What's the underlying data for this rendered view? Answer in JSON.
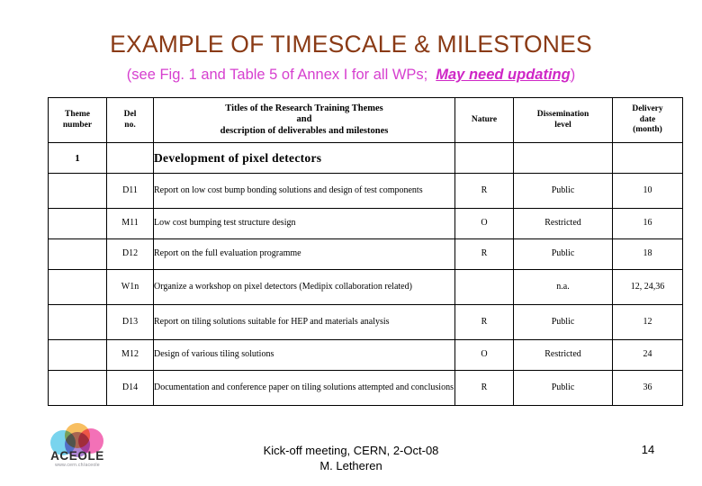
{
  "slide": {
    "title": "EXAMPLE OF TIMESCALE & MILESTONES",
    "subtitle_main": "(see Fig. 1 and Table 5 of Annex I for all WPs;",
    "subtitle_emphasis": "May need updating",
    "subtitle_close": ")",
    "title_color": "#8a3a15",
    "subtitle_color": "#d63fcf",
    "emphasis_color": "#cf27c6"
  },
  "table": {
    "headers": {
      "theme_number": "Theme\nnumber",
      "theme_number_line1": "Theme",
      "theme_number_line2": "number",
      "del_no_line1": "Del",
      "del_no_line2": "no.",
      "titles_line1": "Titles of the Research Training Themes",
      "titles_line2": "and",
      "titles_line3": "description of deliverables and milestones",
      "nature": "Nature",
      "dissemination_line1": "Dissemination",
      "dissemination_line2": "level",
      "delivery_line1": "Delivery",
      "delivery_line2": "date",
      "delivery_line3": "(month)"
    },
    "theme_row": {
      "number": "1",
      "title": "Development of pixel detectors"
    },
    "rows": [
      {
        "theme": "",
        "del_no": "D11",
        "description": "Report on low cost bump bonding solutions and design of test components",
        "nature": "R",
        "dissemination": "Public",
        "delivery": "10"
      },
      {
        "theme": "",
        "del_no": "M11",
        "description": "Low cost bumping test structure design",
        "nature": "O",
        "dissemination": "Restricted",
        "delivery": "16"
      },
      {
        "theme": "",
        "del_no": "D12",
        "description": "Report on the full evaluation programme",
        "nature": "R",
        "dissemination": "Public",
        "delivery": "18"
      },
      {
        "theme": "",
        "del_no": "W1n",
        "description": "Organize a workshop on pixel detectors (Medipix collaboration related)",
        "nature": "",
        "dissemination": "n.a.",
        "delivery": "12, 24,36"
      },
      {
        "theme": "",
        "del_no": "D13",
        "description": "Report on tiling solutions suitable for HEP and materials analysis",
        "nature": "R",
        "dissemination": "Public",
        "delivery": "12"
      },
      {
        "theme": "",
        "del_no": "M12",
        "description": "Design of various tiling solutions",
        "nature": "O",
        "dissemination": "Restricted",
        "delivery": "24"
      },
      {
        "theme": "",
        "del_no": "D14",
        "description": "Documentation and conference paper on tiling solutions attempted and conclusions",
        "nature": "R",
        "dissemination": "Public",
        "delivery": "36"
      }
    ]
  },
  "footer": {
    "line1": "Kick-off meeting, CERN, 2-Oct-08",
    "line2": "M. Letheren",
    "page_number": "14"
  },
  "logo": {
    "wordmark": "ACEOLE",
    "url": "www.cern.ch/aceole",
    "ring_colors": {
      "orange": "#f5a623",
      "cyan": "#45c4e8",
      "purple": "#8e57c4",
      "pink": "#ee3a9b"
    }
  }
}
